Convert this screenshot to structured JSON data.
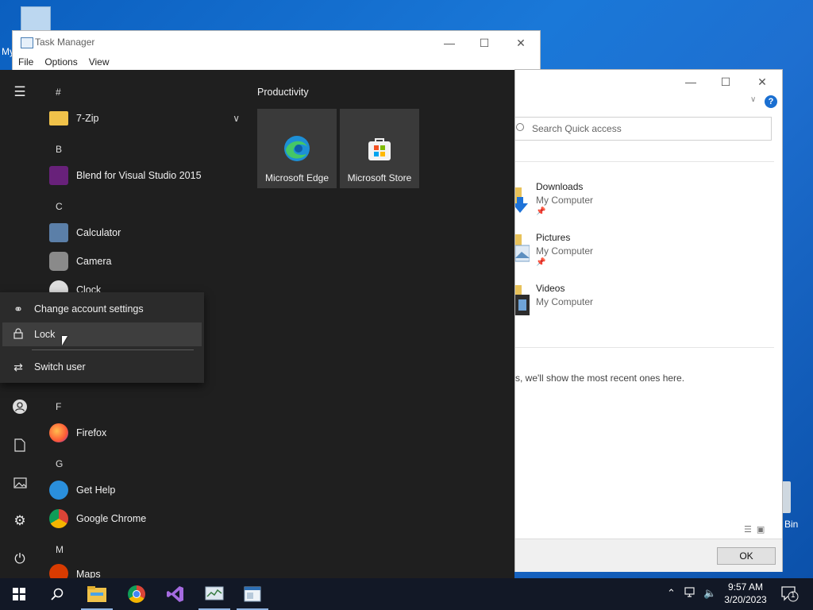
{
  "desktop": {
    "icon_label_partial": "My",
    "recycle_bin_label_partial": "Bin"
  },
  "task_manager": {
    "title": "Task Manager",
    "menu": [
      "File",
      "Options",
      "View"
    ],
    "buttons": {
      "minimize": "—",
      "maximize": "☐",
      "close": "✕"
    }
  },
  "explorer": {
    "buttons": {
      "minimize": "—",
      "maximize": "☐",
      "close": "✕"
    },
    "help_glyph": "?",
    "search_placeholder": "Search Quick access",
    "quick_access": [
      {
        "name": "Downloads",
        "location": "My Computer",
        "pinned": true
      },
      {
        "name": "Pictures",
        "location": "My Computer",
        "pinned": true
      },
      {
        "name": "Videos",
        "location": "My Computer",
        "pinned": false
      }
    ],
    "recent_message": "s, we'll show the most recent ones here.",
    "ok_label": "OK"
  },
  "start_menu": {
    "tiles_group": "Productivity",
    "tiles": [
      {
        "label": "Microsoft Edge",
        "icon": "edge-icon"
      },
      {
        "label": "Microsoft Store",
        "icon": "store-icon"
      }
    ],
    "apps": {
      "h_hash": "#",
      "zip": "7-Zip",
      "h_b": "B",
      "blend": "Blend for Visual Studio 2015",
      "h_c": "C",
      "calculator": "Calculator",
      "camera": "Camera",
      "clock": "Clock",
      "h_f": "F",
      "firefox": "Firefox",
      "h_g": "G",
      "gethelp": "Get Help",
      "chrome": "Google Chrome",
      "h_m": "M",
      "maps": "Maps"
    },
    "account_flyout": {
      "change": "Change account settings",
      "lock": "Lock",
      "switch": "Switch user"
    }
  },
  "taskbar": {
    "time": "9:57 AM",
    "date": "3/20/2023",
    "notification_count": "1",
    "pinned": [
      "file-explorer-icon",
      "chrome-icon",
      "visual-studio-icon",
      "task-manager-icon",
      "window-icon"
    ]
  },
  "colors": {
    "start_bg": "#1f1f1f",
    "tile_bg": "#3a3a3a",
    "accent": "#1a6fd1",
    "taskbar_bg": "#121826"
  }
}
